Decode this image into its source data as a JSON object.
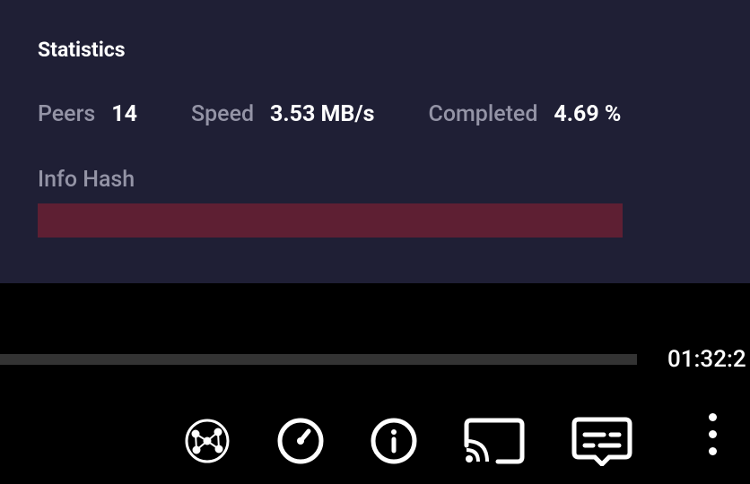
{
  "stats": {
    "title": "Statistics",
    "peers": {
      "label": "Peers",
      "value": "14"
    },
    "speed": {
      "label": "Speed",
      "value": "3.53 MB/s"
    },
    "completed": {
      "label": "Completed",
      "value": "4.69 %"
    },
    "infoHash": {
      "label": "Info Hash",
      "value": ""
    }
  },
  "player": {
    "time": "01:32:2"
  }
}
